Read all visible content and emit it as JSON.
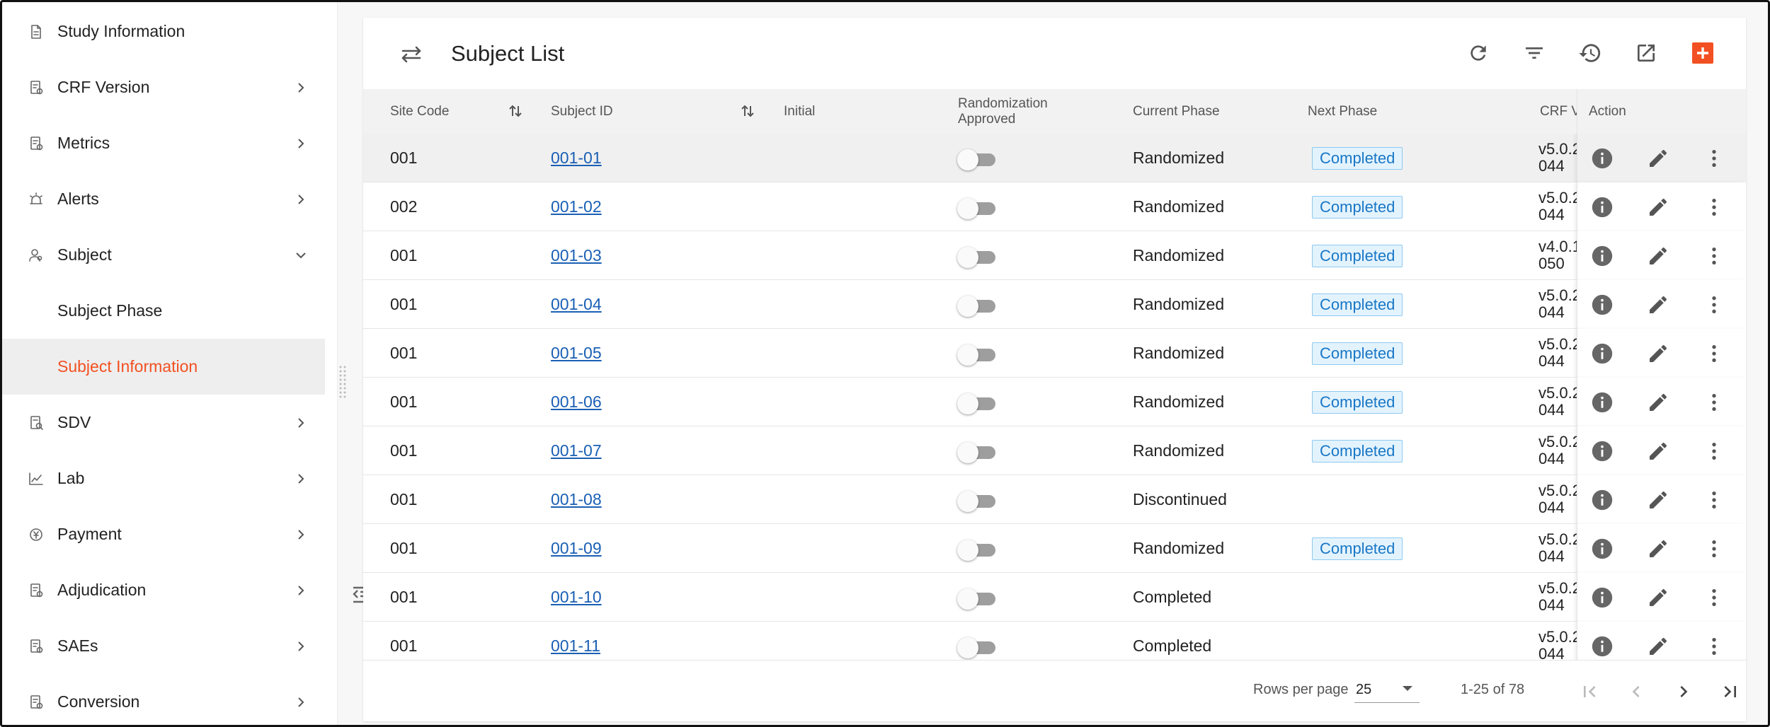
{
  "sidebar": {
    "items": [
      {
        "label": "Study Information",
        "icon": "document-icon",
        "chevron": false
      },
      {
        "label": "CRF Version",
        "icon": "form-version-icon",
        "chevron": "right"
      },
      {
        "label": "Metrics",
        "icon": "metrics-icon",
        "chevron": "right"
      },
      {
        "label": "Alerts",
        "icon": "alarm-icon",
        "chevron": "right"
      },
      {
        "label": "Subject",
        "icon": "subject-icon",
        "chevron": "down"
      },
      {
        "label": "Subject Phase",
        "icon": "",
        "chevron": false
      },
      {
        "label": "Subject Information",
        "icon": "",
        "chevron": false,
        "active": true
      },
      {
        "label": "SDV",
        "icon": "sdv-icon",
        "chevron": "right"
      },
      {
        "label": "Lab",
        "icon": "chart-line-icon",
        "chevron": "right"
      },
      {
        "label": "Payment",
        "icon": "payment-icon",
        "chevron": "right"
      },
      {
        "label": "Adjudication",
        "icon": "adjudication-icon",
        "chevron": "right"
      },
      {
        "label": "SAEs",
        "icon": "sae-icon",
        "chevron": "right"
      },
      {
        "label": "Conversion",
        "icon": "conversion-icon",
        "chevron": "right"
      }
    ]
  },
  "header": {
    "title": "Subject List",
    "toolbar": [
      "refresh-icon",
      "filter-icon",
      "history-icon",
      "open-external-icon",
      "add-icon"
    ]
  },
  "table": {
    "columns": {
      "site_code": "Site Code",
      "subject_id": "Subject ID",
      "initial": "Initial",
      "rand_line1": "Randomization",
      "rand_line2": "Approved",
      "current_phase": "Current Phase",
      "next_phase": "Next Phase",
      "crf_version": "CRF V",
      "action": "Action"
    },
    "rows": [
      {
        "site": "001",
        "subject": "001-01",
        "phase": "Randomized",
        "next": "Completed",
        "crf1": "v5.0.2",
        "crf2": "044",
        "highlighted": true
      },
      {
        "site": "002",
        "subject": "001-02",
        "phase": "Randomized",
        "next": "Completed",
        "crf1": "v5.0.2",
        "crf2": "044"
      },
      {
        "site": "001",
        "subject": "001-03",
        "phase": "Randomized",
        "next": "Completed",
        "crf1": "v4.0.1",
        "crf2": "050"
      },
      {
        "site": "001",
        "subject": "001-04",
        "phase": "Randomized",
        "next": "Completed",
        "crf1": "v5.0.2",
        "crf2": "044"
      },
      {
        "site": "001",
        "subject": "001-05",
        "phase": "Randomized",
        "next": "Completed",
        "crf1": "v5.0.2",
        "crf2": "044"
      },
      {
        "site": "001",
        "subject": "001-06",
        "phase": "Randomized",
        "next": "Completed",
        "crf1": "v5.0.2",
        "crf2": "044"
      },
      {
        "site": "001",
        "subject": "001-07",
        "phase": "Randomized",
        "next": "Completed",
        "crf1": "v5.0.2",
        "crf2": "044"
      },
      {
        "site": "001",
        "subject": "001-08",
        "phase": "Discontinued",
        "next": "",
        "crf1": "v5.0.2",
        "crf2": "044"
      },
      {
        "site": "001",
        "subject": "001-09",
        "phase": "Randomized",
        "next": "Completed",
        "crf1": "v5.0.2",
        "crf2": "044"
      },
      {
        "site": "001",
        "subject": "001-10",
        "phase": "Completed",
        "next": "",
        "crf1": "v5.0.2",
        "crf2": "044"
      },
      {
        "site": "001",
        "subject": "001-11",
        "phase": "Completed",
        "next": "",
        "crf1": "v5.0.2",
        "crf2": "044"
      }
    ]
  },
  "footer": {
    "rows_per_page_label": "Rows per page",
    "rows_per_page": "25",
    "range": "1-25 of 78"
  },
  "colors": {
    "accent": "#f25022",
    "link": "#1a5fb4",
    "badge_text": "#1977c6",
    "badge_bg": "#e3f3fd"
  }
}
